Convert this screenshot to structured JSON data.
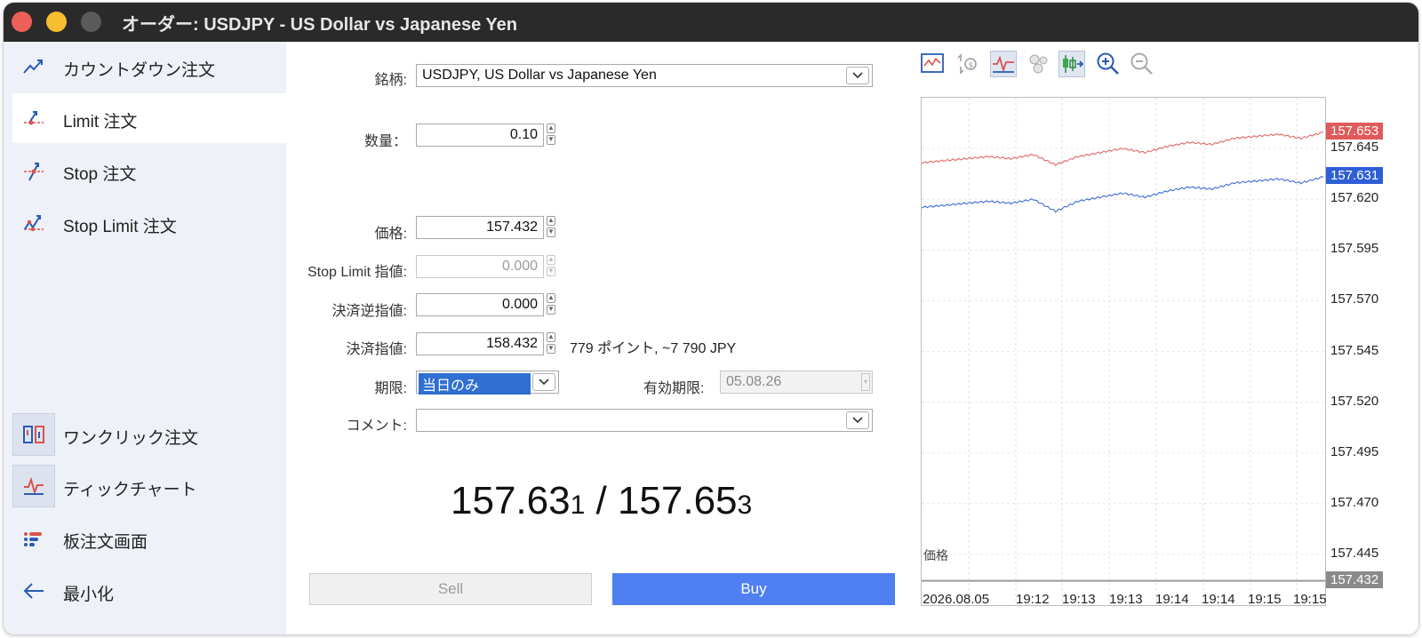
{
  "window": {
    "title": "オーダー: USDJPY - US Dollar vs Japanese Yen"
  },
  "sidebar": {
    "items": [
      {
        "label": "カウントダウン注文",
        "icon": "countdown-order-icon"
      },
      {
        "label": "Limit 注文",
        "icon": "limit-order-icon"
      },
      {
        "label": "Stop 注文",
        "icon": "stop-order-icon"
      },
      {
        "label": "Stop Limit 注文",
        "icon": "stop-limit-order-icon"
      }
    ],
    "bottom_items": [
      {
        "label": "ワンクリック注文",
        "icon": "one-click-icon"
      },
      {
        "label": "ティックチャート",
        "icon": "tick-chart-icon"
      },
      {
        "label": "板注文画面",
        "icon": "depth-of-market-icon"
      },
      {
        "label": "最小化",
        "icon": "arrow-left-icon"
      }
    ]
  },
  "form": {
    "symbol": {
      "label": "銘柄:",
      "value": "USDJPY, US Dollar vs Japanese Yen"
    },
    "volume": {
      "label": "数量：",
      "value": "0.10"
    },
    "price": {
      "label": "価格:",
      "value": "157.432"
    },
    "stop_limit": {
      "label": "Stop Limit 指値:",
      "value": "0.000"
    },
    "stop_loss": {
      "label": "決済逆指値:",
      "value": "0.000"
    },
    "take_profit": {
      "label": "決済指値:",
      "value": "158.432",
      "points": "779 ポイント, ~7 790 JPY"
    },
    "expiration": {
      "label": "期限:",
      "value": "当日のみ"
    },
    "expiry_date": {
      "label": "有効期限:",
      "value": "05.08.26"
    },
    "comment": {
      "label": "コメント:",
      "value": ""
    },
    "quote": {
      "bid_main": "157.63",
      "bid_small": "1",
      "separator": " / ",
      "ask_main": "157.65",
      "ask_small": "3"
    },
    "sell_label": "Sell",
    "buy_label": "Buy"
  },
  "chart_data": {
    "type": "line",
    "x": [
      "19:12:00",
      "19:12:12",
      "19:12:24",
      "19:12:36",
      "19:12:48",
      "19:13:00",
      "19:13:12",
      "19:13:24",
      "19:13:36",
      "19:13:48",
      "19:14:00",
      "19:14:12",
      "19:14:24",
      "19:14:36",
      "19:14:48",
      "19:15:00",
      "19:15:12",
      "19:15:24",
      "19:15:36"
    ],
    "series": [
      {
        "name": "Ask",
        "color": "#e05a5a",
        "values": [
          157.638,
          157.639,
          157.64,
          157.641,
          157.64,
          157.642,
          157.637,
          157.641,
          157.643,
          157.645,
          157.643,
          157.646,
          157.648,
          157.647,
          157.65,
          157.651,
          157.652,
          157.65,
          157.653
        ]
      },
      {
        "name": "Bid",
        "color": "#2f5fd6",
        "values": [
          157.616,
          157.617,
          157.618,
          157.619,
          157.618,
          157.62,
          157.614,
          157.619,
          157.621,
          157.623,
          157.621,
          157.624,
          157.626,
          157.625,
          157.628,
          157.629,
          157.63,
          157.628,
          157.631
        ]
      }
    ],
    "price_line": {
      "label": "価格",
      "value": 157.432
    },
    "y_ticks": [
      "157.645",
      "157.620",
      "157.595",
      "157.570",
      "157.545",
      "157.520",
      "157.495",
      "157.470",
      "157.445"
    ],
    "x_ticks": [
      "2026.08.05",
      "19:12",
      "19:13",
      "19:13",
      "19:14",
      "19:14",
      "19:15",
      "19:15"
    ],
    "tags": {
      "ask": "157.653",
      "bid": "157.631",
      "price": "157.432"
    },
    "ylim": [
      157.42,
      157.67
    ],
    "tag_colors": {
      "ask": "#e05a5a",
      "bid": "#2f5fd6",
      "price": "#8a8a8a"
    }
  },
  "toolbar": {
    "icons": [
      "chart-window-icon",
      "trade-levels-icon",
      "tick-chart-mode-icon",
      "bubbles-icon",
      "candles-icon",
      "zoom-in-icon",
      "zoom-out-icon"
    ]
  }
}
